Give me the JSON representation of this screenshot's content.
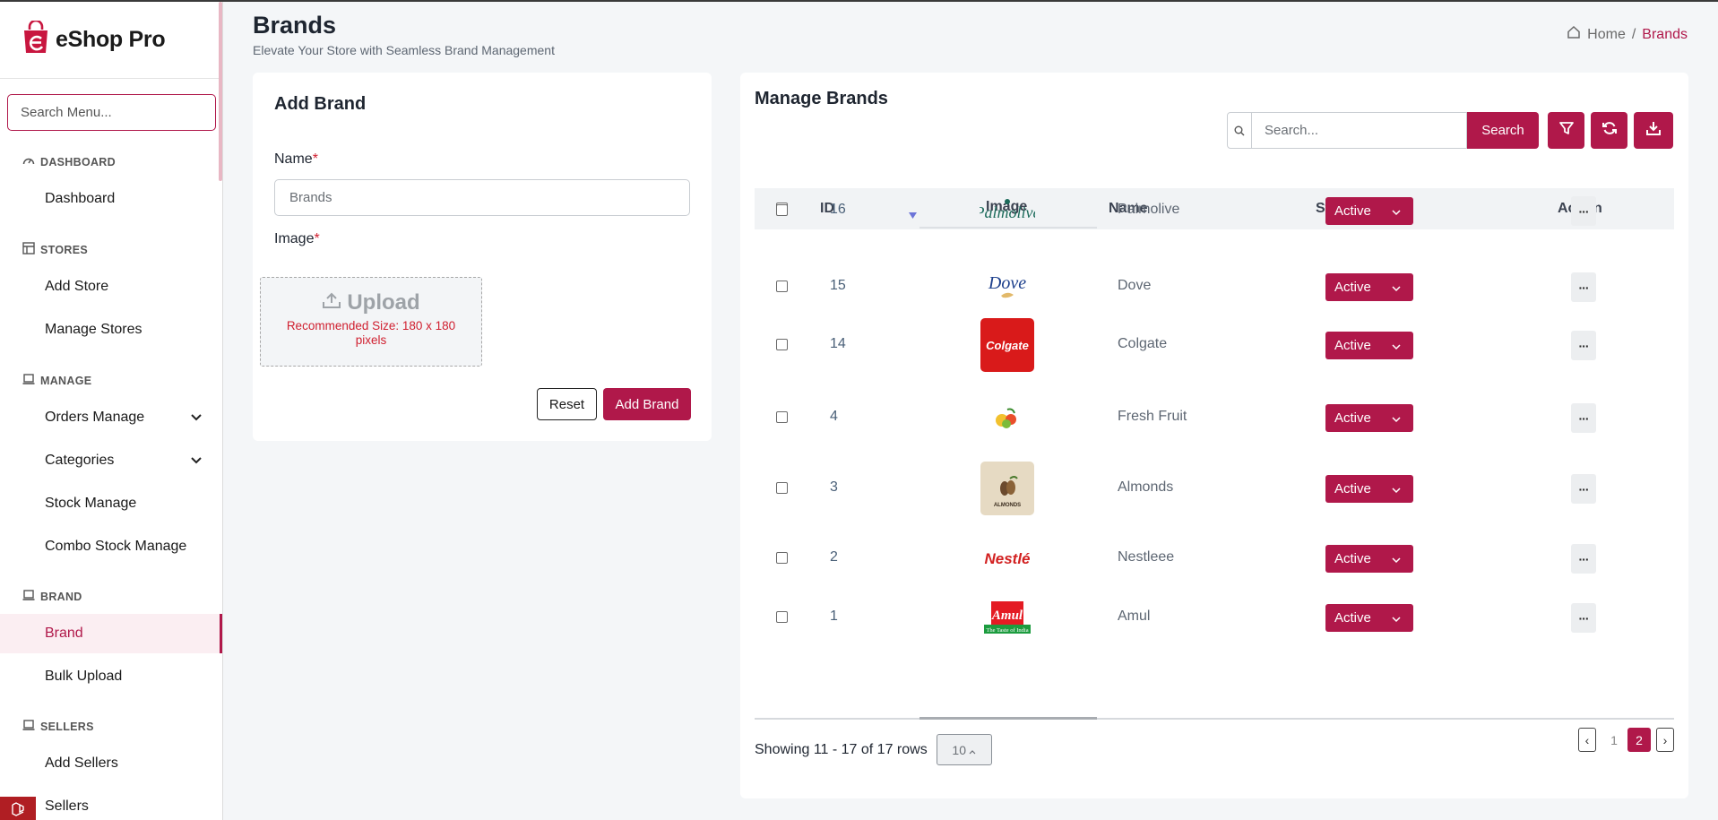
{
  "app": {
    "name": "eShop Pro"
  },
  "sidebar": {
    "search_placeholder": "Search Menu...",
    "sections": [
      {
        "title": "DASHBOARD",
        "items": [
          {
            "label": "Dashboard"
          }
        ]
      },
      {
        "title": "STORES",
        "items": [
          {
            "label": "Add Store"
          },
          {
            "label": "Manage Stores"
          }
        ]
      },
      {
        "title": "MANAGE",
        "items": [
          {
            "label": "Orders Manage",
            "expandable": true
          },
          {
            "label": "Categories",
            "expandable": true
          },
          {
            "label": "Stock Manage"
          },
          {
            "label": "Combo Stock Manage"
          }
        ]
      },
      {
        "title": "BRAND",
        "items": [
          {
            "label": "Brand",
            "active": true
          },
          {
            "label": "Bulk Upload"
          }
        ]
      },
      {
        "title": "SELLERS",
        "items": [
          {
            "label": "Add Sellers"
          },
          {
            "label": "Sellers"
          }
        ]
      }
    ]
  },
  "header": {
    "title": "Brands",
    "subtitle": "Elevate Your Store with Seamless Brand Management",
    "breadcrumb": {
      "home": "Home",
      "separator": "/",
      "current": "Brands"
    }
  },
  "add_brand": {
    "title": "Add Brand",
    "name_label": "Name",
    "required_mark": "*",
    "name_placeholder": "Brands",
    "image_label": "Image",
    "upload_label": "Upload",
    "upload_note": "Recommended Size: 180 x 180 pixels",
    "reset_label": "Reset",
    "submit_label": "Add Brand"
  },
  "manage": {
    "title": "Manage Brands",
    "search_placeholder": "Search...",
    "search_button": "Search",
    "icons": [
      "filter-icon",
      "refresh-icon",
      "download-icon"
    ],
    "columns": {
      "id": "ID",
      "image": "Image",
      "name": "Name",
      "status": "Status",
      "action": "Action"
    },
    "rows": [
      {
        "id": "16",
        "name": "Palmolive",
        "status": "Active",
        "logo": "palmolive-logo"
      },
      {
        "id": "15",
        "name": "Dove",
        "status": "Active",
        "logo": "dove-logo"
      },
      {
        "id": "14",
        "name": "Colgate",
        "status": "Active",
        "logo": "colgate-logo"
      },
      {
        "id": "4",
        "name": "Fresh Fruit",
        "status": "Active",
        "logo": "fresh-fruit-logo"
      },
      {
        "id": "3",
        "name": "Almonds",
        "status": "Active",
        "logo": "almonds-logo"
      },
      {
        "id": "2",
        "name": "Nestleee",
        "status": "Active",
        "logo": "nestle-logo"
      },
      {
        "id": "1",
        "name": "Amul",
        "status": "Active",
        "logo": "amul-logo"
      }
    ],
    "action_glyph": "···",
    "footer": {
      "showing": "Showing 11 - 17 of 17 rows",
      "page_size": "10",
      "pages": [
        "1",
        "2"
      ],
      "current_page": "2",
      "prev": "‹",
      "next": "›"
    }
  },
  "colors": {
    "accent": "#b0184a",
    "background": "#f4f6f8"
  }
}
